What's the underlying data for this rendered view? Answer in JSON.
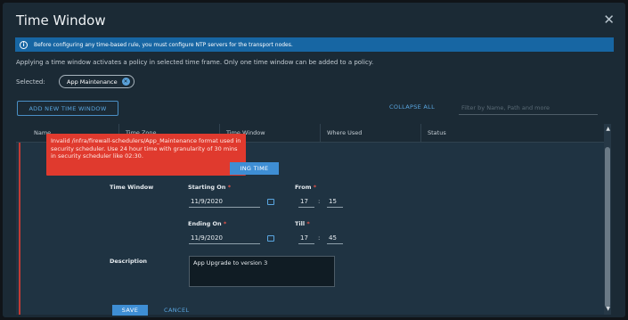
{
  "dialog": {
    "title": "Time Window",
    "close_glyph": "✕"
  },
  "banner": {
    "icon": "info-icon",
    "icon_glyph": "i",
    "text": "Before configuring any time-based rule, you must configure NTP servers for the transport nodes."
  },
  "description": "Applying a time window activates a policy in selected time frame. Only one time window can be added to a policy.",
  "selected": {
    "label": "Selected:",
    "chip_text": "App Maintenance",
    "chip_remove_glyph": "✕"
  },
  "toolbar": {
    "add_button": "ADD NEW TIME WINDOW",
    "collapse_all": "COLLAPSE ALL",
    "filter_placeholder": "Filter by Name, Path and more"
  },
  "table": {
    "headers": [
      "Name",
      "Time Zone",
      "Time Window",
      "Where Used",
      "Status"
    ]
  },
  "error": {
    "text": "Invalid /infra/firewall-schedulers/App_Maintenance format used in security scheduler. Use 24 hour time with granularity of 30 mins in security scheduler like 02:30."
  },
  "form": {
    "timezone_button": "ING TIME",
    "time_window_label": "Time Window",
    "starting_on_label": "Starting On",
    "starting_on_value": "11/9/2020",
    "from_label": "From",
    "from_hour": "17",
    "from_minute": "15",
    "ending_on_label": "Ending On",
    "ending_on_value": "11/9/2020",
    "till_label": "Till",
    "till_hour": "17",
    "till_minute": "45",
    "required_mark": "*",
    "colon": ":",
    "description_label": "Description",
    "description_value": "App Upgrade to version 3"
  },
  "actions": {
    "save": "SAVE",
    "cancel": "CANCEL"
  },
  "colors": {
    "accent": "#3e8ed4",
    "error": "#e03a2e",
    "banner": "#1766a3",
    "background": "#1b2a35"
  }
}
